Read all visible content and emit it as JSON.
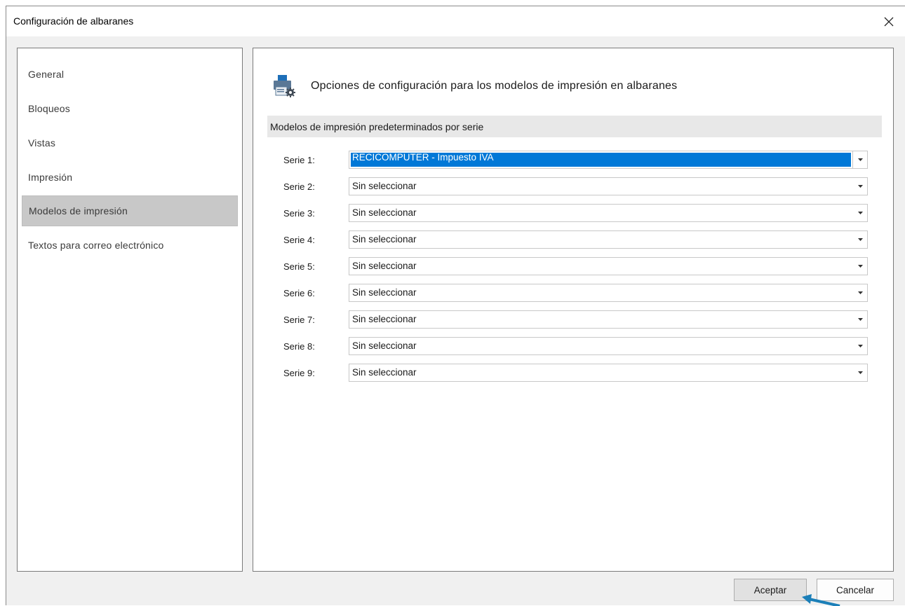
{
  "window": {
    "title": "Configuración de albaranes"
  },
  "sidebar": {
    "items": [
      {
        "label": "General"
      },
      {
        "label": "Bloqueos"
      },
      {
        "label": "Vistas"
      },
      {
        "label": "Impresión"
      },
      {
        "label": "Modelos de impresión",
        "selected": true
      },
      {
        "label": "Textos para correo electrónico"
      }
    ]
  },
  "main": {
    "header_icon": "printer-settings-icon",
    "header": "Opciones de configuración para los modelos de impresión en albaranes",
    "section_title": "Modelos de impresión predeterminados por serie",
    "series": [
      {
        "label": "Serie 1:",
        "value": "RECICOMPUTER - Impuesto IVA"
      },
      {
        "label": "Serie 2:",
        "value": "Sin seleccionar"
      },
      {
        "label": "Serie 3:",
        "value": "Sin seleccionar"
      },
      {
        "label": "Serie 4:",
        "value": "Sin seleccionar"
      },
      {
        "label": "Serie 5:",
        "value": "Sin seleccionar"
      },
      {
        "label": "Serie 6:",
        "value": "Sin seleccionar"
      },
      {
        "label": "Serie 7:",
        "value": "Sin seleccionar"
      },
      {
        "label": "Serie 8:",
        "value": "Sin seleccionar"
      },
      {
        "label": "Serie 9:",
        "value": "Sin seleccionar"
      }
    ]
  },
  "buttons": {
    "ok": "Aceptar",
    "cancel": "Cancelar"
  },
  "colors": {
    "selection": "#0078d7",
    "cursor_arrow": "#1b7fb8"
  }
}
